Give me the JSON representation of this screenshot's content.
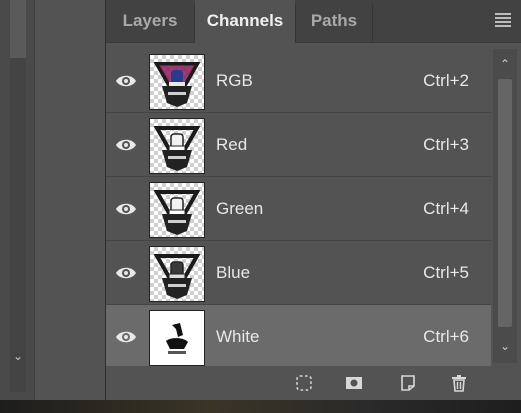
{
  "tabs": [
    {
      "label": "Layers",
      "active": false
    },
    {
      "label": "Channels",
      "active": true
    },
    {
      "label": "Paths",
      "active": false
    }
  ],
  "channels": [
    {
      "name": "RGB",
      "shortcut": "Ctrl+2",
      "thumb": "color",
      "visible": true,
      "selected": false
    },
    {
      "name": "Red",
      "shortcut": "Ctrl+3",
      "thumb": "gray",
      "visible": true,
      "selected": false
    },
    {
      "name": "Green",
      "shortcut": "Ctrl+4",
      "thumb": "gray",
      "visible": true,
      "selected": false
    },
    {
      "name": "Blue",
      "shortcut": "Ctrl+5",
      "thumb": "gray",
      "visible": true,
      "selected": false
    },
    {
      "name": "White",
      "shortcut": "Ctrl+6",
      "thumb": "white",
      "visible": true,
      "selected": true
    }
  ],
  "footer_icons": [
    "load-selection-icon",
    "save-selection-mask-icon",
    "new-channel-icon",
    "delete-channel-icon"
  ],
  "colors": {
    "panel_bg": "#535353",
    "tab_bar_bg": "#424242",
    "selected_row_bg": "#6b6b6b",
    "text": "#e8e8e8"
  }
}
